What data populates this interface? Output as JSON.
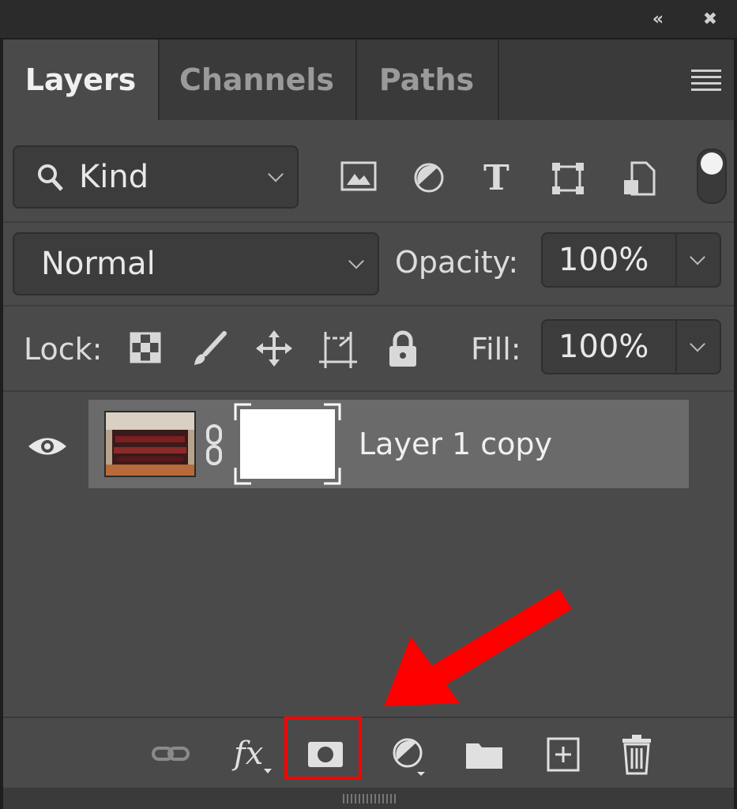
{
  "window": {
    "collapse_icon": "double-chevron-left-icon",
    "close_icon": "close-icon",
    "collapse_glyph": "«",
    "close_glyph": "✖"
  },
  "tabs": [
    {
      "label": "Layers",
      "active": true
    },
    {
      "label": "Channels",
      "active": false
    },
    {
      "label": "Paths",
      "active": false
    }
  ],
  "filter": {
    "kind_label": "Kind",
    "icons": [
      "image-filter-icon",
      "adjustment-filter-icon",
      "type-filter-icon",
      "shape-filter-icon",
      "smart-object-filter-icon"
    ],
    "type_glyph": "T"
  },
  "blend": {
    "mode": "Normal",
    "opacity_label": "Opacity:",
    "opacity_value": "100%"
  },
  "lock": {
    "label": "Lock:",
    "icons": [
      "lock-transparent-pixels-icon",
      "lock-image-pixels-icon",
      "lock-position-icon",
      "lock-artboard-icon",
      "lock-all-icon"
    ],
    "fill_label": "Fill:",
    "fill_value": "100%"
  },
  "layers": [
    {
      "name": "Layer 1 copy",
      "visible": true,
      "has_mask": true,
      "linked": true
    }
  ],
  "footer": {
    "buttons": [
      "link-layers-icon",
      "fx-icon",
      "add-layer-mask-icon",
      "adjustment-layer-icon",
      "group-folder-icon",
      "new-layer-icon",
      "trash-icon"
    ],
    "fx_label": "fx"
  },
  "colors": {
    "highlight": "#ff0000",
    "panel_bg": "#4a4a4a",
    "selected_row": "#6a6a6a"
  }
}
